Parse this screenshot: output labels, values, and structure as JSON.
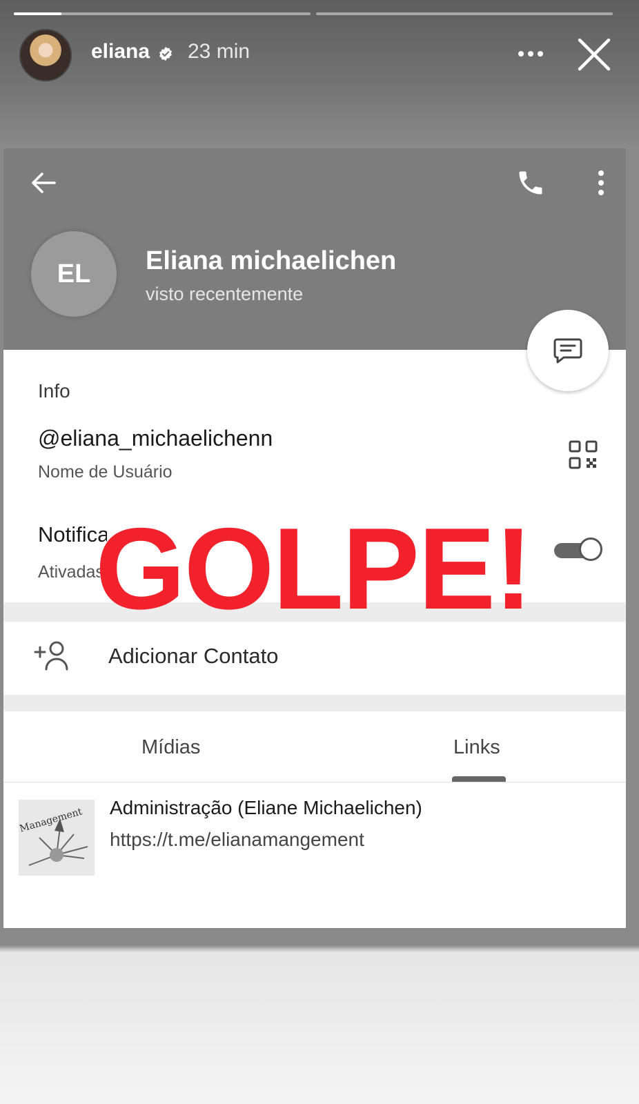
{
  "story": {
    "username": "eliana",
    "verified": true,
    "time": "23 min",
    "progress": [
      0.1,
      0.0
    ]
  },
  "app": {
    "contact_avatar": "EL",
    "contact_name": "Eliana michaelichen",
    "contact_status": "visto recentemente",
    "info": {
      "heading": "Info",
      "username": "@eliana_michaelichenn",
      "username_caption": "Nome de Usuário",
      "notifications_label": "Notificações",
      "notifications_value": "Ativadas",
      "notifications_on": true
    },
    "add_contact_label": "Adicionar Contato",
    "tabs": [
      {
        "label": "Mídias",
        "active": false
      },
      {
        "label": "Links",
        "active": true
      }
    ],
    "link": {
      "thumbnail_text": "Management",
      "title": "Administração (Eliane Michaelichen)",
      "url": "https://t.me/elianamangement"
    }
  },
  "overlay": {
    "text": "GOLPE!",
    "color": "#f2222d"
  },
  "icons": [
    "verified-badge-icon",
    "more-horizontal-icon",
    "close-icon",
    "back-arrow-icon",
    "phone-icon",
    "more-vertical-icon",
    "message-icon",
    "qr-code-icon",
    "add-contact-icon"
  ]
}
